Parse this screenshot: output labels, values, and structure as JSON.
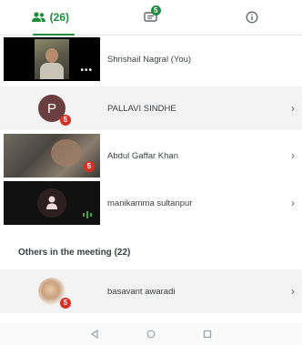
{
  "tabs": {
    "people_label": "(26)",
    "chat_badge": "5"
  },
  "participants": [
    {
      "name": "Shrishail Nagral (You)"
    },
    {
      "name": "PALLAVI SINDHE",
      "initial": "P",
      "badge": "5"
    },
    {
      "name": "Abdul Gaffar Khan",
      "badge": "5"
    },
    {
      "name": "manikamma sultanpur"
    }
  ],
  "others": {
    "label": "Others in the meeting (22)",
    "items": [
      {
        "name": "basavant awaradi",
        "badge": "5"
      }
    ]
  },
  "colors": {
    "accent": "#1e8e3e",
    "badge": "#d93025",
    "avatar_p": "#6b3f3f"
  }
}
